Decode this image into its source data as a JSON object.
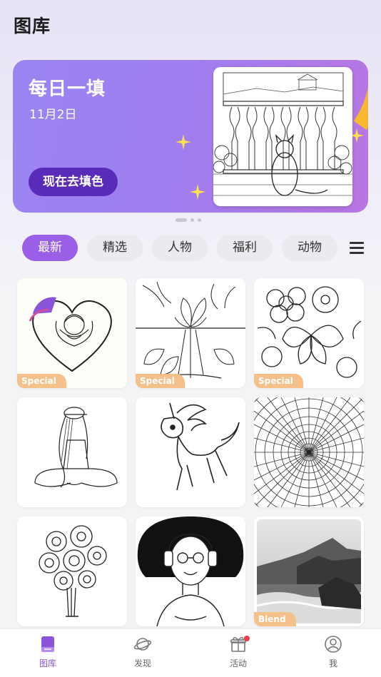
{
  "header": {
    "title": "图库"
  },
  "banner": {
    "title": "每日一填",
    "date": "11月2日",
    "button_label": "现在去填色",
    "accent_color": "#f6b731",
    "button_color": "#5a2bb8"
  },
  "tabs": [
    {
      "label": "最新",
      "active": true
    },
    {
      "label": "精选"
    },
    {
      "label": "人物"
    },
    {
      "label": "福利"
    },
    {
      "label": "动物"
    }
  ],
  "tab_menu_icon": "hamburger-menu-icon",
  "tiles": [
    {
      "subject": "rose-heart",
      "badge": "Special"
    },
    {
      "subject": "lotus",
      "badge": "Special"
    },
    {
      "subject": "flowers-butterfly",
      "badge": "Special"
    },
    {
      "subject": "sitting-girl",
      "badge": ""
    },
    {
      "subject": "unicorn",
      "badge": ""
    },
    {
      "subject": "radial-pattern",
      "badge": ""
    },
    {
      "subject": "rose-bouquet",
      "badge": ""
    },
    {
      "subject": "woman-headphones",
      "badge": ""
    },
    {
      "subject": "coastal-rocks-photo",
      "badge": "Blend"
    }
  ],
  "bottom_nav": [
    {
      "label": "图库",
      "icon": "gallery-icon",
      "active": true
    },
    {
      "label": "发现",
      "icon": "planet-icon"
    },
    {
      "label": "活动",
      "icon": "gift-icon",
      "notification_dot": true
    },
    {
      "label": "我",
      "icon": "profile-icon"
    }
  ],
  "colors": {
    "tab_active": "#9a5fe6",
    "nav_active": "#8c55d9",
    "badge": "#f4c18a"
  }
}
